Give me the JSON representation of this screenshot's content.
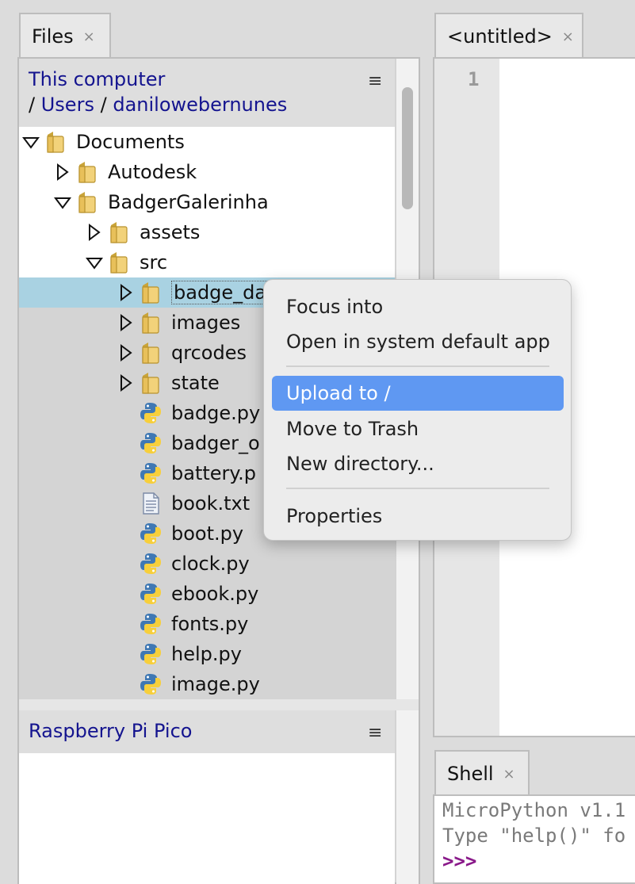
{
  "files_tab": {
    "label": "Files",
    "close": "×"
  },
  "editor_tab": {
    "label": "<untitled>",
    "close": "×"
  },
  "shell_tab": {
    "label": "Shell",
    "close": "×"
  },
  "menu_glyph": "≡",
  "this_computer": {
    "title": "This computer",
    "path_sep": "/",
    "path": [
      "Users",
      "danilowebernunes"
    ]
  },
  "tree": [
    {
      "label": "Documents",
      "type": "folder",
      "expanded": true
    },
    {
      "label": "Autodesk",
      "type": "folder",
      "expanded": false
    },
    {
      "label": "BadgerGalerinha",
      "type": "folder",
      "expanded": true
    },
    {
      "label": "assets",
      "type": "folder",
      "expanded": false
    },
    {
      "label": "src",
      "type": "folder",
      "expanded": true
    },
    {
      "label": "badge_da",
      "type": "folder",
      "expanded": false,
      "selected": true
    },
    {
      "label": "images",
      "type": "folder",
      "expanded": false
    },
    {
      "label": "qrcodes",
      "type": "folder",
      "expanded": false
    },
    {
      "label": "state",
      "type": "folder",
      "expanded": false
    },
    {
      "label": "badge.py",
      "type": "python"
    },
    {
      "label": "badger_o",
      "type": "python"
    },
    {
      "label": "battery.p",
      "type": "python"
    },
    {
      "label": "book.txt",
      "type": "text"
    },
    {
      "label": "boot.py",
      "type": "python"
    },
    {
      "label": "clock.py",
      "type": "python"
    },
    {
      "label": "ebook.py",
      "type": "python"
    },
    {
      "label": "fonts.py",
      "type": "python"
    },
    {
      "label": "help.py",
      "type": "python"
    },
    {
      "label": "image.py",
      "type": "python"
    }
  ],
  "device": {
    "title": "Raspberry Pi Pico"
  },
  "editor": {
    "line_number": "1"
  },
  "shell": {
    "line1": "MicroPython v1.1",
    "line2": "Type \"help()\" fo",
    "prompt": ">>>"
  },
  "context_menu": {
    "focus_into": "Focus into",
    "open_default": "Open in system default app",
    "upload": "Upload to /",
    "move_trash": "Move to Trash",
    "new_directory": "New directory...",
    "properties": "Properties"
  }
}
